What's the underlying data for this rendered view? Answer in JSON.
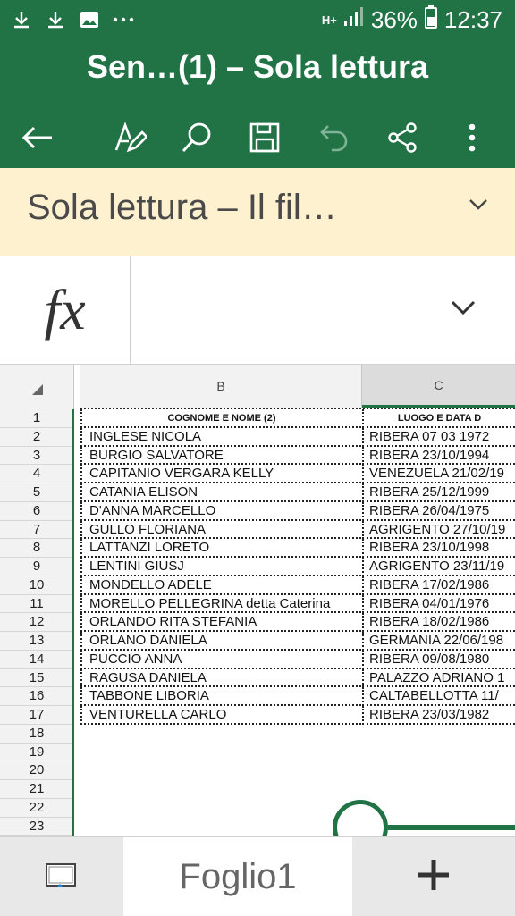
{
  "status": {
    "network": "H+",
    "battery": "36%",
    "time": "12:37",
    "icons": [
      "download-icon",
      "download-icon",
      "image-icon",
      "more-dots-icon",
      "signal-icon",
      "battery-icon"
    ]
  },
  "app": {
    "title": "Sen…(1) – Sola lettura",
    "toolbar": [
      "back-arrow-icon",
      "edit-icon",
      "search-icon",
      "save-icon",
      "undo-icon",
      "share-icon",
      "more-vert-icon"
    ],
    "accent": "#217346"
  },
  "banner": {
    "text": "Sola lettura – Il fil…"
  },
  "formula": {
    "fx_label": "fx"
  },
  "sheet": {
    "columns": [
      "B",
      "C"
    ],
    "rows": [
      {
        "n": "1",
        "b": "COGNOME E NOME (2)",
        "c": "LUOGO E DATA D"
      },
      {
        "n": "2",
        "b": "INGLESE NICOLA",
        "c": "RIBERA  07 03 1972"
      },
      {
        "n": "3",
        "b": "BURGIO SALVATORE",
        "c": "RIBERA 23/10/1994"
      },
      {
        "n": "4",
        "b": "CAPITANIO VERGARA  KELLY",
        "c": "VENEZUELA 21/02/19"
      },
      {
        "n": "5",
        "b": "CATANIA ELISON",
        "c": "RIBERA 25/12/1999"
      },
      {
        "n": "6",
        "b": "D'ANNA MARCELLO",
        "c": "RIBERA 26/04/1975"
      },
      {
        "n": "7",
        "b": "GULLO FLORIANA",
        "c": "AGRIGENTO 27/10/19"
      },
      {
        "n": "8",
        "b": "LATTANZI LORETO",
        "c": "RIBERA 23/10/1998"
      },
      {
        "n": "9",
        "b": "LENTINI GIUSJ",
        "c": "AGRIGENTO 23/11/19"
      },
      {
        "n": "10",
        "b": "MONDELLO ADELE",
        "c": "RIBERA 17/02/1986"
      },
      {
        "n": "11",
        "b": "MORELLO PELLEGRINA detta Caterina",
        "c": "RIBERA 04/01/1976"
      },
      {
        "n": "12",
        "b": "ORLANDO RITA STEFANIA",
        "c": "RIBERA 18/02/1986"
      },
      {
        "n": "13",
        "b": "ORLANO DANIELA",
        "c": "GERMANIA 22/06/198"
      },
      {
        "n": "14",
        "b": "PUCCIO ANNA",
        "c": "RIBERA 09/08/1980"
      },
      {
        "n": "15",
        "b": "RAGUSA DANIELA",
        "c": "PALAZZO ADRIANO 1"
      },
      {
        "n": "16",
        "b": "TABBONE LIBORIA",
        "c": "CALTABELLOTTA 11/"
      },
      {
        "n": "17",
        "b": "VENTURELLA CARLO",
        "c": "RIBERA 23/03/1982"
      },
      {
        "n": "18",
        "b": "",
        "c": ""
      },
      {
        "n": "19",
        "b": "",
        "c": ""
      },
      {
        "n": "20",
        "b": "",
        "c": ""
      },
      {
        "n": "21",
        "b": "",
        "c": ""
      },
      {
        "n": "22",
        "b": "",
        "c": ""
      },
      {
        "n": "23",
        "b": "",
        "c": ""
      }
    ]
  },
  "tabs": {
    "sheet_name": "Foglio1",
    "add_label": "+"
  }
}
